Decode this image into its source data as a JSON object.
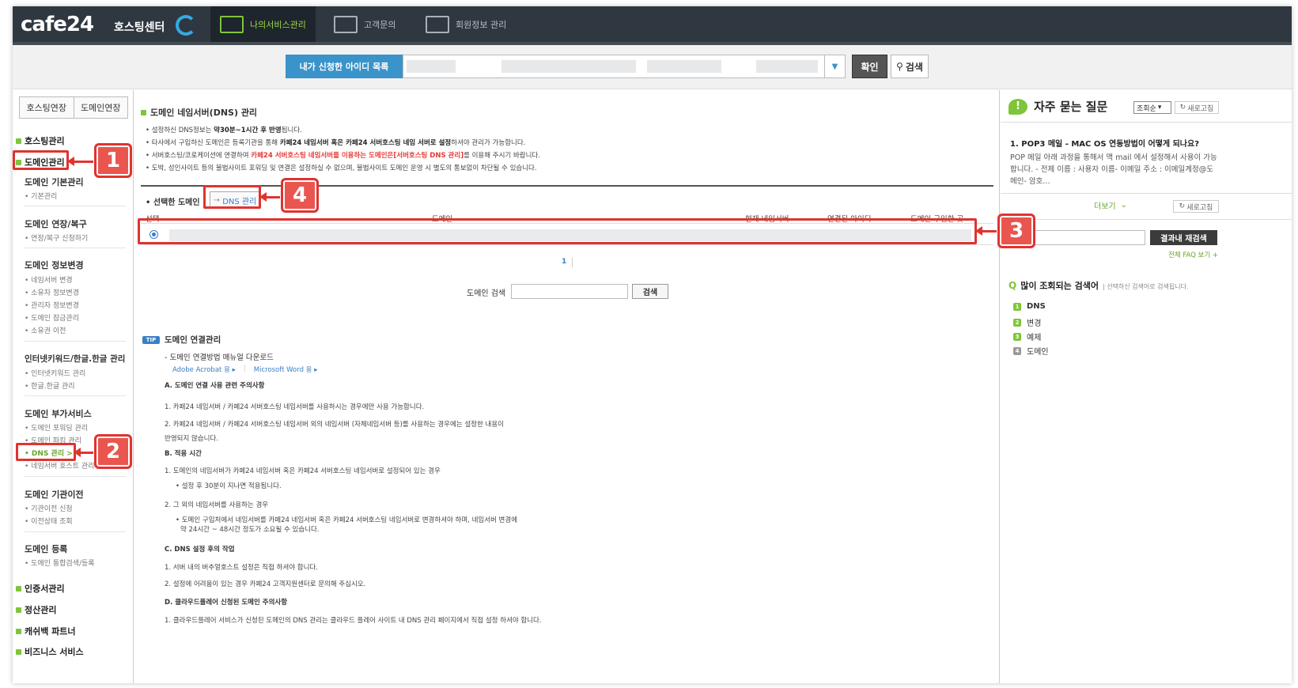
{
  "header": {
    "logo": "cafe24",
    "logo_sub": "호스팅센터",
    "tabs": [
      {
        "label": "나의서비스관리",
        "active": true
      },
      {
        "label": "고객문의",
        "active": false
      },
      {
        "label": "회원정보 관리",
        "active": false
      }
    ]
  },
  "searchbar": {
    "id_list_label": "내가 신청한 아이디 목록",
    "confirm_label": "확인",
    "search_label": "검색"
  },
  "sidebar": {
    "ext_tabs": [
      "호스팅연장",
      "도메인연장"
    ],
    "main_items": [
      "호스팅관리",
      "도메인관리",
      "인증서관리",
      "정산관리",
      "캐쉬백 파트너",
      "비즈니스 서비스"
    ],
    "groups": [
      {
        "title": "도메인 기본관리",
        "items": [
          "기본관리"
        ]
      },
      {
        "title": "도메인 연장/복구",
        "items": [
          "연장/복구 신청하기"
        ]
      },
      {
        "title": "도메인 정보변경",
        "items": [
          "네임서버 변경",
          "소유자 정보변경",
          "관리자 정보변경",
          "도메인 잠금관리",
          "소유권 이전"
        ]
      },
      {
        "title": "인터넷키워드/한글.한글 관리",
        "items": [
          "인터넷키워드 관리",
          "한글.한글 관리"
        ]
      },
      {
        "title": "도메인 부가서비스",
        "items": [
          "도메인 포워딩 관리",
          "도메인 파킹 관리",
          "DNS 관리 >",
          "네임서버 호스트 관리"
        ]
      },
      {
        "title": "도메인 기관이전",
        "items": [
          "기관이전 신청",
          "이전상태 조회"
        ]
      },
      {
        "title": "도메인 등록",
        "items": [
          "도메인 통합검색/등록"
        ]
      }
    ]
  },
  "main": {
    "title": "도메인 네임서버(DNS) 관리",
    "notes": [
      {
        "parts": [
          {
            "t": "설정하신 DNS정보는 "
          },
          {
            "t": "약30분~1시간 후 반영",
            "b": true
          },
          {
            "t": "됩니다."
          }
        ]
      },
      {
        "parts": [
          {
            "t": "타사에서 구입하신 도메인은 등록기관을 통해 "
          },
          {
            "t": "카페24 네임서버 혹은 카페24 서버호스팅 네임 서버로 설정",
            "b": true
          },
          {
            "t": "하셔야 관리가 가능합니다."
          }
        ]
      },
      {
        "parts": [
          {
            "t": "서버호스팅/코로케이션에 연결하여 "
          },
          {
            "t": "카페24 서버호스팅 네임서버를 이용하는 도메인은[서버호스팅 DNS 관리]",
            "r": true
          },
          {
            "t": "를 이용해 주시기 바랍니다."
          }
        ]
      },
      {
        "parts": [
          {
            "t": "도박, 성인사이트 등의 불법사이트 포워딩 및 연결은 설정하실 수 없으며, 불법사이트 도메인 운영 시 별도의 통보없이 차단될 수 있습니다."
          }
        ]
      }
    ],
    "selected_domain_label": "선택한 도메인",
    "dns_button_label": "DNS 관리",
    "table_headers": [
      "선택",
      "도메인",
      "현재 네임서버",
      "연결된 아이디",
      "도메인 구입한 곳"
    ],
    "page_number": "1",
    "domain_search_label": "도메인 검색",
    "domain_search_button": "검색",
    "tip": {
      "badge": "TIP",
      "title": "도메인 연결관리",
      "manual": "- 도메인 연결방법 매뉴얼 다운로드",
      "links": [
        "Adobe Acrobat 용 ▸",
        "Microsoft Word 용 ▸"
      ],
      "lines": [
        {
          "text": "A. 도메인 연결 사용 관련 주의사항",
          "h": true
        },
        {
          "text": "1. 카페24 네임서버 / 카페24 서버호스팅 네임서버를 사용하시는 경우에만 사용 가능합니다."
        },
        {
          "text": "2. 카페24 네임서버 / 카페24 서버호스팅 네임서버 외의 네임서버 (자체네임서버 등)를 사용하는 경우에는 설정한 내용이"
        },
        {
          "text": "반영되지 않습니다."
        },
        {
          "text": "B. 적용 시간",
          "h": true
        },
        {
          "text": "1. 도메인의 네임서버가 카페24 네임서버 혹은 카페24 서버호스팅 네임서버로 설정되어 있는 경우"
        },
        {
          "text": "• 설정 후 30분이 지나면 적용됩니다.",
          "indent": true
        },
        {
          "text": "2. 그 외의 네임서버를 사용하는 경우"
        },
        {
          "text": "• 도메인 구입처에서 네임서버를 카페24 네임서버 혹은 카페24 서버호스팅 네임서버로 변경하셔야 하며, 네임서버 변경에",
          "indent": true
        },
        {
          "text": "약 24시간 ~ 48시간 정도가 소요될 수 있습니다.",
          "indent2": true
        },
        {
          "text": "C. DNS 설정 후의 작업",
          "h": true
        },
        {
          "text": "1. 서버 내의 버추얼호스트 설정은 직접 하셔야 합니다."
        },
        {
          "text": "2. 설정에 어려움이 있는 경우 카페24 고객지원센터로 문의해 주십시오."
        },
        {
          "text": "D. 클라우드플레어 신청된 도메인 주의사항",
          "h": true
        },
        {
          "text": "1. 클라우드플레어 서비스가 신청된 도메인의 DNS 관리는 클라우드 플레어 사이트 내 DNS 관리 페이지에서 직접 설정 하셔야 합니다."
        }
      ]
    }
  },
  "right": {
    "faq_title": "자주 묻는 질문",
    "sort_label": "조회순",
    "refresh_label": "새로고침",
    "faq_question": "1. POP3 메일 - MAC OS 연동방법이 어떻게 되나요?",
    "faq_answer": "POP 메일 아래 과정을 통해서 맥 mail 에서 설정해서 사용이 가능합니다. - 전체 이름 : 사용자 이름- 이메일 주소 : 이메일계정@도메인- 암호...",
    "more_label": "더보기",
    "result_search_button": "결과내 재검색",
    "faq_all_link": "전체 FAQ 보기 +",
    "popular_title": "많이 조회되는 검색어",
    "popular_note": "선택하신 검색어로 검색됩니다.",
    "popular_terms": [
      "DNS",
      "변경",
      "예제",
      "도메인"
    ]
  },
  "annotations": [
    "1",
    "2",
    "3",
    "4"
  ]
}
